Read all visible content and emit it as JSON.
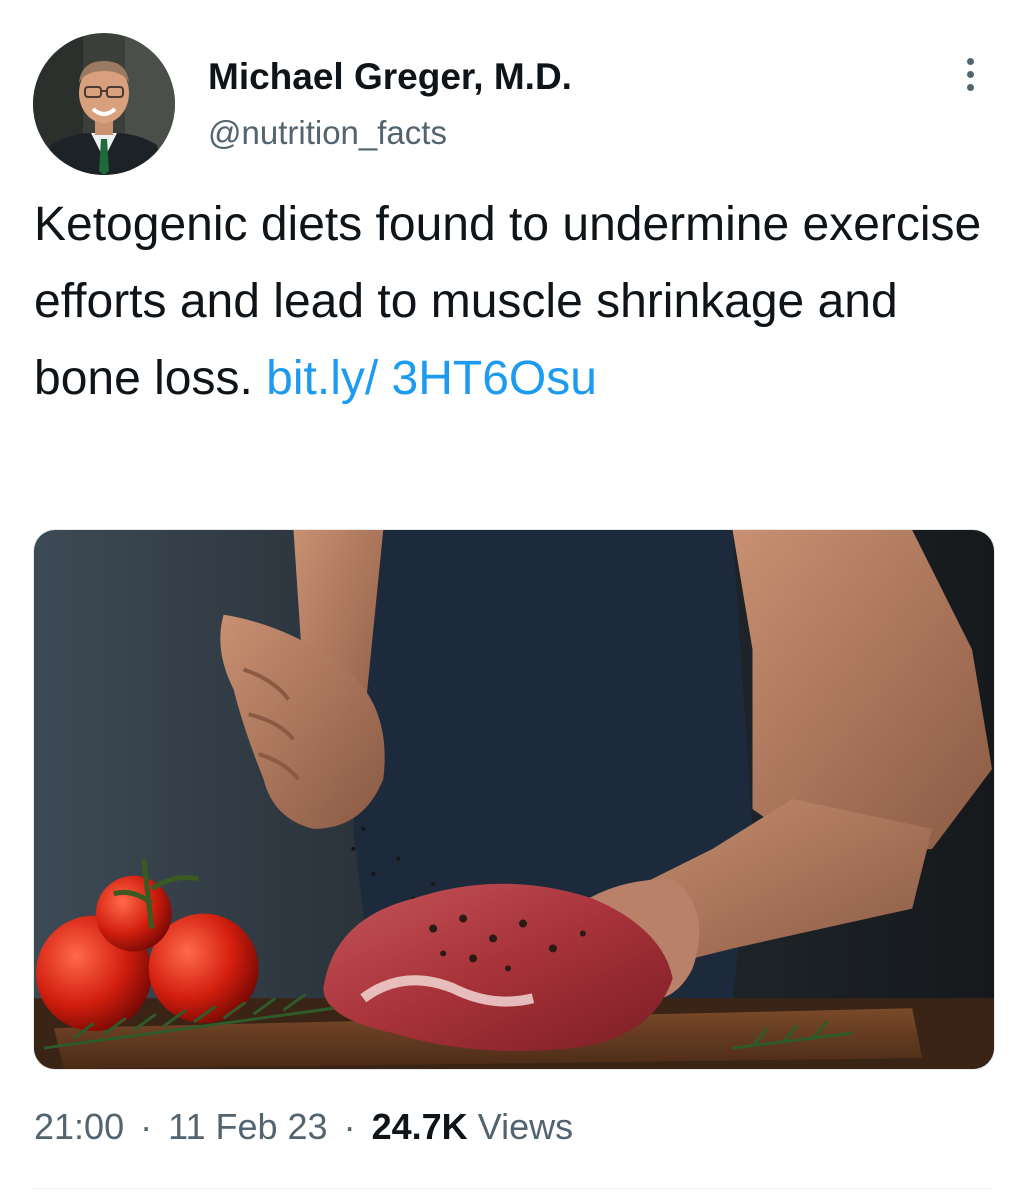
{
  "author": {
    "name": "Michael Greger, M.D.",
    "handle": "@nutrition_facts",
    "avatar_icon": "profile-photo"
  },
  "tweet": {
    "text": "Ketogenic diets found to undermine exercise efforts and lead to muscle shrinkage and bone loss. ",
    "link_text": "bit.ly/ 3HT6Osu",
    "media_alt": "photo"
  },
  "meta": {
    "time": "21:00",
    "date": "11 Feb 23",
    "views_count": "24.7K",
    "views_label": "Views",
    "separator": "·"
  },
  "colors": {
    "link": "#1d9bf0",
    "secondary_text": "#536471",
    "primary_text": "#0f1419"
  }
}
